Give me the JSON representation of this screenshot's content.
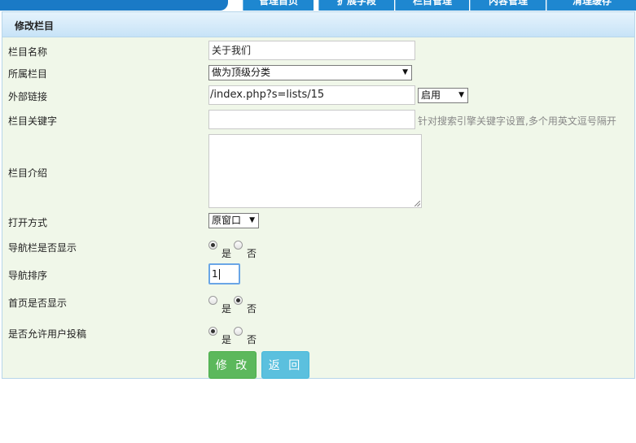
{
  "nav": {
    "tabs": [
      "管理首页",
      "扩展字段",
      "栏目管理",
      "内容管理",
      "清理缓存"
    ]
  },
  "panel": {
    "title": "修改栏目"
  },
  "form": {
    "name": {
      "label": "栏目名称",
      "value": "关于我们"
    },
    "parent": {
      "label": "所属栏目",
      "selected": "做为顶级分类"
    },
    "link": {
      "label": "外部链接",
      "value": "/index.php?s=lists/15",
      "status_selected": "启用"
    },
    "keywords": {
      "label": "栏目关键字",
      "value": "",
      "hint": "针对搜索引擎关键字设置,多个用英文逗号隔开"
    },
    "intro": {
      "label": "栏目介绍",
      "value": ""
    },
    "open_mode": {
      "label": "打开方式",
      "selected": "原窗口"
    },
    "nav_show": {
      "label": "导航栏是否显示",
      "yes": "是",
      "no": "否",
      "selected": "yes"
    },
    "nav_order": {
      "label": "导航排序",
      "value": "1"
    },
    "home_show": {
      "label": "首页是否显示",
      "yes": "是",
      "no": "否",
      "selected": "no"
    },
    "allow_submit": {
      "label": "是否允许用户投稿",
      "yes": "是",
      "no": "否",
      "selected": "yes"
    }
  },
  "buttons": {
    "submit": "修 改",
    "back": "返 回"
  },
  "colors": {
    "submit": "#5cb85c",
    "back": "#5bc0de",
    "panel_bg": "#f0f7e9",
    "nav_blue": "#1e87d0"
  }
}
